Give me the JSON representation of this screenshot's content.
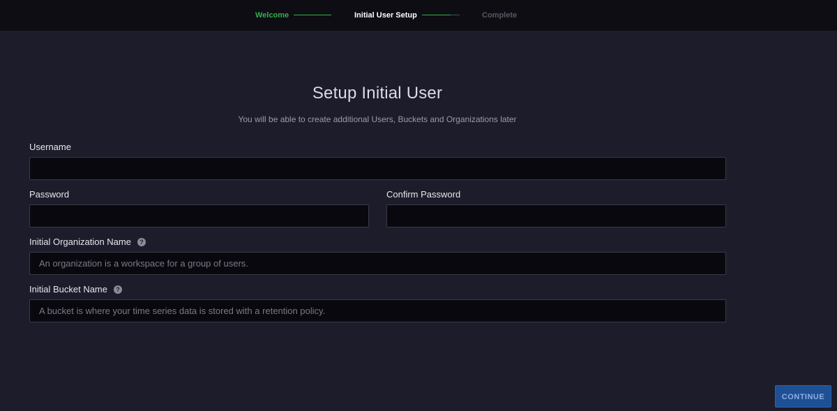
{
  "wizard": {
    "steps": [
      {
        "label": "Welcome",
        "state": "done"
      },
      {
        "label": "Initial User Setup",
        "state": "active"
      },
      {
        "label": "Complete",
        "state": "pending"
      }
    ],
    "connector_progress": [
      1.0,
      0.75
    ]
  },
  "form": {
    "title": "Setup Initial User",
    "subtitle": "You will be able to create additional Users, Buckets and Organizations later",
    "username": {
      "label": "Username",
      "value": "",
      "placeholder": ""
    },
    "password": {
      "label": "Password",
      "value": "",
      "placeholder": ""
    },
    "confirm_password": {
      "label": "Confirm Password",
      "value": "",
      "placeholder": ""
    },
    "organization": {
      "label": "Initial Organization Name",
      "value": "",
      "placeholder": "An organization is a workspace for a group of users.",
      "icon": "help-icon"
    },
    "bucket": {
      "label": "Initial Bucket Name",
      "value": "",
      "placeholder": "A bucket is where your time series data is stored with a retention policy.",
      "icon": "help-icon"
    }
  },
  "footer": {
    "continue_label": "CONTINUE"
  },
  "colors": {
    "background": "#1c1c2a",
    "topbar": "#0d0d13",
    "step_done": "#32b04c",
    "step_pending": "#575768",
    "button": "#1f4f94"
  }
}
